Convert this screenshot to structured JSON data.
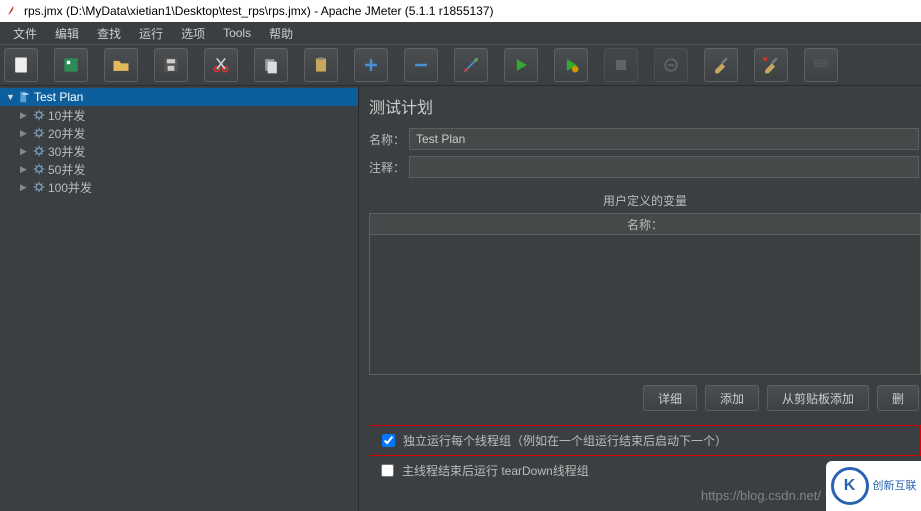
{
  "window": {
    "title": "rps.jmx (D:\\MyData\\xietian1\\Desktop\\test_rps\\rps.jmx) - Apache JMeter (5.1.1 r1855137)"
  },
  "menu": {
    "file": "文件",
    "edit": "编辑",
    "search": "查找",
    "run": "运行",
    "options": "选项",
    "tools": "Tools",
    "help": "帮助"
  },
  "tree": {
    "root": "Test Plan",
    "nodes": [
      {
        "label": "10并发"
      },
      {
        "label": "20并发"
      },
      {
        "label": "30并发"
      },
      {
        "label": "50并发"
      },
      {
        "label": "100并发"
      }
    ]
  },
  "panel": {
    "title": "测试计划",
    "name_label": "名称：",
    "name_value": "Test Plan",
    "comment_label": "注释：",
    "comment_value": "",
    "vars_header": "用户定义的变量",
    "col_name": "名称：",
    "btn_detail": "详细",
    "btn_add": "添加",
    "btn_add_clip": "从剪贴板添加",
    "btn_del": "删",
    "check1": "独立运行每个线程组（例如在一个组运行结束后启动下一个）",
    "check2": "主线程结束后运行 tearDown线程组"
  },
  "watermark": "https://blog.csdn.net/",
  "badge": {
    "glyph": "K",
    "text": "创新互联"
  }
}
